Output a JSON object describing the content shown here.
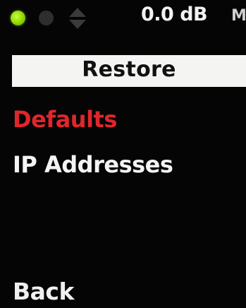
{
  "status": {
    "level": "0.0 dB",
    "mode": "M",
    "colors": {
      "active_led": "#8fd400",
      "inactive_led": "#2e2e2e"
    }
  },
  "title": "Restore",
  "menu": {
    "items": [
      {
        "label": "Defaults",
        "selected": true,
        "color": "#e0262b"
      },
      {
        "label": "IP Addresses",
        "selected": false,
        "color": "#f4f4f4"
      }
    ]
  },
  "footer": {
    "back_label": "Back"
  }
}
